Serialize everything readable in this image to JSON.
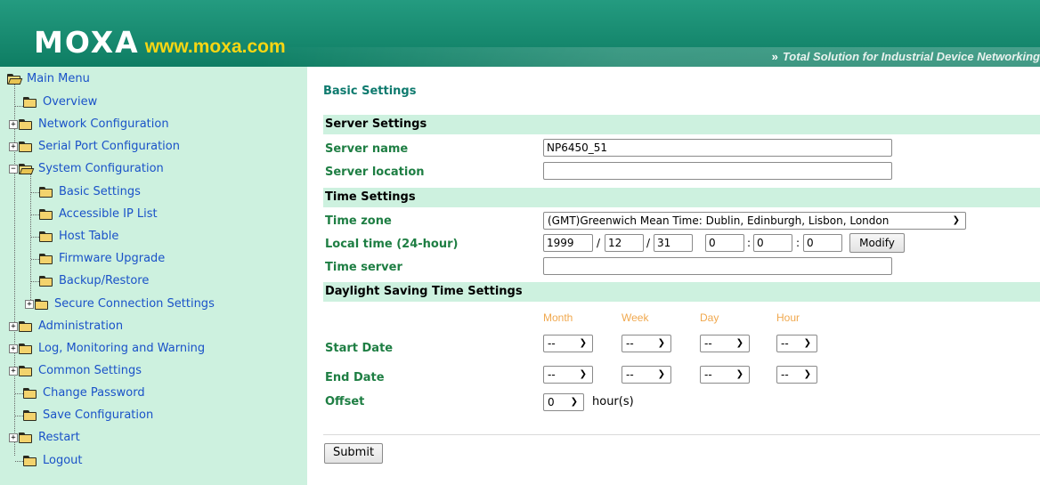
{
  "header": {
    "brand": "MOXA",
    "url": "www.moxa.com",
    "tagline": "Total Solution for Industrial Device Networking",
    "tagline_chevron": "»"
  },
  "sidebar": {
    "items": [
      {
        "label": "Main Menu",
        "toggle": "",
        "open": true
      },
      {
        "label": "Overview",
        "toggle": "",
        "open": false
      },
      {
        "label": "Network Configuration",
        "toggle": "+",
        "open": false
      },
      {
        "label": "Serial Port Configuration",
        "toggle": "+",
        "open": false
      },
      {
        "label": "System Configuration",
        "toggle": "−",
        "open": true
      },
      {
        "label": "Basic Settings",
        "toggle": "",
        "open": false
      },
      {
        "label": "Accessible IP List",
        "toggle": "",
        "open": false
      },
      {
        "label": "Host Table",
        "toggle": "",
        "open": false
      },
      {
        "label": "Firmware Upgrade",
        "toggle": "",
        "open": false
      },
      {
        "label": "Backup/Restore",
        "toggle": "",
        "open": false
      },
      {
        "label": "Secure Connection Settings",
        "toggle": "+",
        "open": false
      },
      {
        "label": "Administration",
        "toggle": "+",
        "open": false
      },
      {
        "label": "Log, Monitoring and Warning",
        "toggle": "+",
        "open": false
      },
      {
        "label": "Common Settings",
        "toggle": "+",
        "open": false
      },
      {
        "label": "Change Password",
        "toggle": "",
        "open": false
      },
      {
        "label": "Save Configuration",
        "toggle": "",
        "open": false
      },
      {
        "label": "Restart",
        "toggle": "+",
        "open": false
      },
      {
        "label": "Logout",
        "toggle": "",
        "open": false
      }
    ]
  },
  "main": {
    "title": "Basic Settings",
    "server_settings": {
      "heading": "Server Settings",
      "server_name_label": "Server name",
      "server_name_value": "NP6450_51",
      "server_location_label": "Server location",
      "server_location_value": ""
    },
    "time_settings": {
      "heading": "Time Settings",
      "time_zone_label": "Time zone",
      "time_zone_value": "(GMT)Greenwich Mean Time: Dublin, Edinburgh, Lisbon, London",
      "local_time_label": "Local time (24-hour)",
      "year": "1999",
      "month": "12",
      "day": "31",
      "hour": "0",
      "minute": "0",
      "second": "0",
      "date_sep": "/",
      "time_sep": ":",
      "modify_label": "Modify",
      "time_server_label": "Time server",
      "time_server_value": ""
    },
    "dst": {
      "heading": "Daylight Saving Time Settings",
      "col_month": "Month",
      "col_week": "Week",
      "col_day": "Day",
      "col_hour": "Hour",
      "start_label": "Start Date",
      "end_label": "End Date",
      "offset_label": "Offset",
      "empty_option": "--",
      "offset_value": "0",
      "offset_unit": "hour(s)"
    },
    "submit_label": "Submit"
  },
  "colors": {
    "header_green": "#0e7d63",
    "url_yellow": "#f7d613",
    "sidebar_bg": "#cdf1df",
    "link_blue": "#1a52c8",
    "label_green": "#1e7e43",
    "dst_orange": "#f0a84e"
  }
}
